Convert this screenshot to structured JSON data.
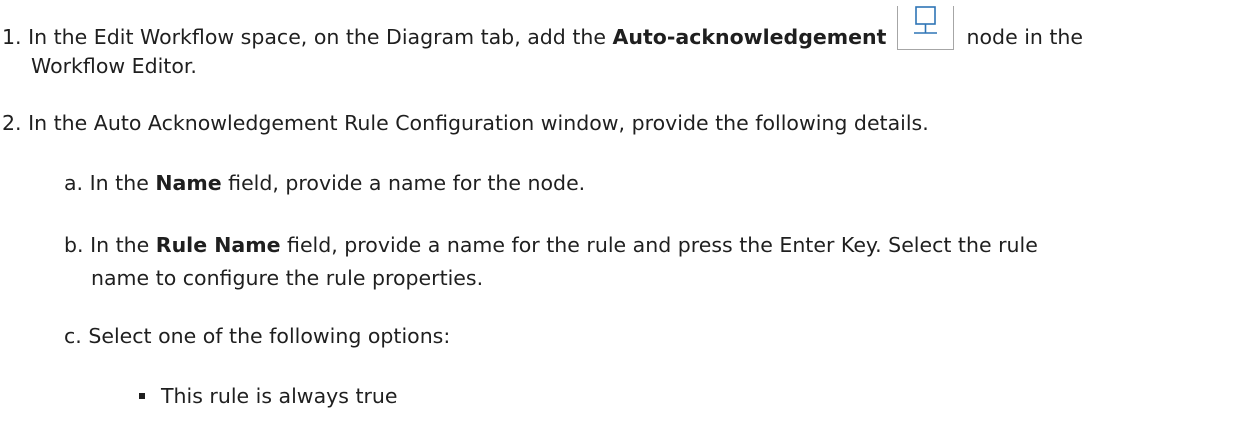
{
  "steps": [
    {
      "number": "1.",
      "text_before": "In the Edit Workflow space, on the Diagram tab, add the",
      "bold": "Auto-acknowledgement",
      "text_after": "node in the",
      "text_line2": "Workflow Editor.",
      "icon": "monitor-node-icon"
    },
    {
      "number": "2.",
      "text": "In the Auto Acknowledgement Rule Configuration window, provide the following details.",
      "substeps": [
        {
          "letter": "a.",
          "before": "In the",
          "bold": "Name",
          "after": "field, provide a name for the node."
        },
        {
          "letter": "b.",
          "before": "In the",
          "bold": "Rule Name",
          "after": "field, provide a name for the rule and press the Enter Key. Select the rule",
          "line2": "name to configure the rule properties."
        },
        {
          "letter": "c.",
          "text": "Select one of the following options:",
          "bullets": [
            "This rule is always true"
          ]
        }
      ]
    }
  ],
  "colors": {
    "text": "#1f1f1f",
    "icon_stroke": "#2e75b6",
    "icon_frame": "#a6a6a6"
  }
}
